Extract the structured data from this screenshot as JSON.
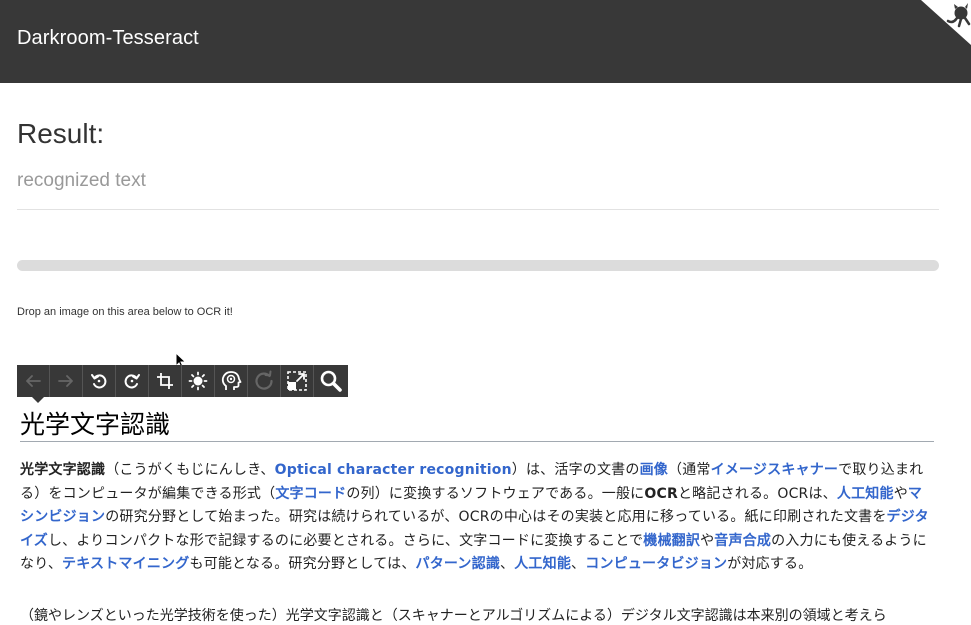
{
  "header": {
    "title": "Darkroom-Tesseract",
    "bg_color": "#383838",
    "corner_icon": "octocat-icon"
  },
  "result": {
    "title": "Result:",
    "placeholder_text": "recognized text"
  },
  "progress": {
    "value": 0
  },
  "drop_hint": "Drop an image on this area below to OCR it!",
  "toolbar": {
    "buttons": [
      {
        "name": "undo-arrow-icon",
        "enabled": false
      },
      {
        "name": "redo-arrow-icon",
        "enabled": false
      },
      {
        "name": "rotate-left-icon",
        "enabled": true
      },
      {
        "name": "rotate-right-icon",
        "enabled": true
      },
      {
        "name": "crop-icon",
        "enabled": true
      },
      {
        "name": "brightness-icon",
        "enabled": true
      },
      {
        "name": "ocr-head-icon",
        "enabled": true
      },
      {
        "name": "reload-icon",
        "enabled": false
      },
      {
        "name": "resize-icon",
        "enabled": true
      },
      {
        "name": "zoom-icon",
        "enabled": true
      }
    ]
  },
  "document": {
    "heading": "光学文字認識",
    "para1": [
      {
        "t": "光学文字認識",
        "s": "b"
      },
      {
        "t": "（こうがくもじにんしき、",
        "s": ""
      },
      {
        "t": "Optical character recognition",
        "s": "a"
      },
      {
        "t": "）は、活字の文書の",
        "s": ""
      },
      {
        "t": "画像",
        "s": "a"
      },
      {
        "t": "（通常",
        "s": ""
      },
      {
        "t": "イメージスキャナー",
        "s": "a"
      },
      {
        "t": "で取り込まれる）をコンピュータが編集できる形式（",
        "s": ""
      },
      {
        "t": "文字コード",
        "s": "a"
      },
      {
        "t": "の列）に変換するソフトウェアである。一般に",
        "s": ""
      },
      {
        "t": "OCR",
        "s": "b"
      },
      {
        "t": "と略記される。OCRは、",
        "s": ""
      },
      {
        "t": "人工知能",
        "s": "a"
      },
      {
        "t": "や",
        "s": ""
      },
      {
        "t": "マシンビジョン",
        "s": "a"
      },
      {
        "t": "の研究分野として始まった。研究は続けられているが、OCRの中心はその実装と応用に移っている。紙に印刷された文書を",
        "s": ""
      },
      {
        "t": "デジタイズ",
        "s": "a"
      },
      {
        "t": "し、よりコンパクトな形で記録するのに必要とされる。さらに、文字コードに変換することで",
        "s": ""
      },
      {
        "t": "機械翻訳",
        "s": "a"
      },
      {
        "t": "や",
        "s": ""
      },
      {
        "t": "音声合成",
        "s": "a"
      },
      {
        "t": "の入力にも使えるようになり、",
        "s": ""
      },
      {
        "t": "テキストマイニング",
        "s": "a"
      },
      {
        "t": "も可能となる。研究分野としては、",
        "s": ""
      },
      {
        "t": "パターン認識",
        "s": "a"
      },
      {
        "t": "、",
        "s": ""
      },
      {
        "t": "人工知能",
        "s": "a"
      },
      {
        "t": "、",
        "s": ""
      },
      {
        "t": "コンピュータビジョン",
        "s": "a"
      },
      {
        "t": "が対応する。",
        "s": ""
      }
    ],
    "para2": "（鏡やレンズといった光学技術を使った）光学文字認識と（スキャナーとアルゴリズムによる）デジタル文字認識は本来別の領域と考えら"
  }
}
